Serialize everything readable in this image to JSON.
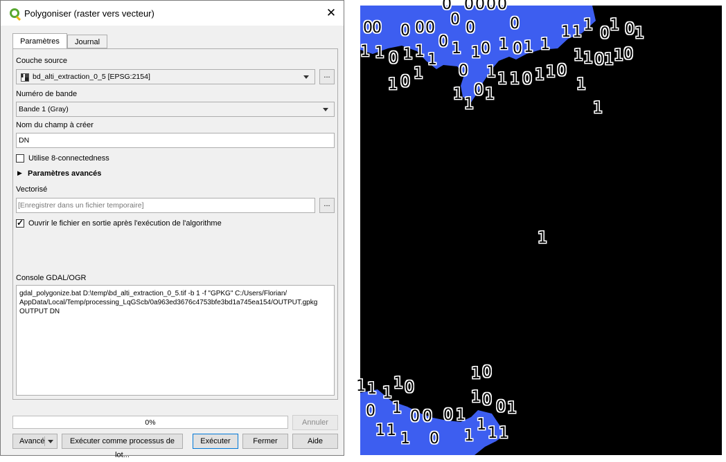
{
  "dialog": {
    "title": "Polygoniser (raster vers vecteur)",
    "close_glyph": "✕",
    "tabs": [
      "Paramètres",
      "Journal"
    ],
    "source_layer": {
      "label": "Couche source",
      "value": "bd_alti_extraction_0_5 [EPSG:2154]",
      "browse": "..."
    },
    "band": {
      "label": "Numéro de bande",
      "value": "Bande 1 (Gray)"
    },
    "field_name": {
      "label": "Nom du champ à créer",
      "value": "DN"
    },
    "eight_connect": {
      "label": "Utilise 8-connectedness",
      "checked": false
    },
    "advanced": {
      "label": "Paramètres avancés"
    },
    "vectorized": {
      "label": "Vectorisé",
      "placeholder": "[Enregistrer dans un fichier temporaire]",
      "browse": "..."
    },
    "open_output": {
      "label": "Ouvrir le fichier en sortie après l'exécution de l'algorithme",
      "checked": true
    },
    "console": {
      "label": "Console GDAL/OGR",
      "lines": [
        "gdal_polygonize.bat D:\\temp\\bd_alti_extraction_0_5.tif -b 1 -f \"GPKG\" C:/Users/Florian/",
        "AppData/Local/Temp/processing_LqGScb/0a963ed3676c4753bfe3bd1a745ea154/OUTPUT.gpkg",
        "OUTPUT DN"
      ]
    },
    "progress": {
      "text": "0%",
      "value": 0
    },
    "buttons": {
      "cancel": "Annuler",
      "advanced": "Avancé",
      "batch": "Exécuter comme processus de lot...",
      "run": "Exécuter",
      "close": "Fermer",
      "help": "Aide"
    }
  },
  "map": {
    "water_color": "#3d5ef0",
    "background_color": "#000000",
    "labels": [
      "0",
      "0",
      "0",
      "0",
      "0",
      "0",
      "0",
      "0",
      "1",
      "0",
      "0",
      "0",
      "0",
      "0",
      "0",
      "1",
      "1",
      "0",
      "1",
      "1",
      "1",
      "1",
      "0",
      "1",
      "0",
      "1",
      "1",
      "1",
      "0",
      "1",
      "0",
      "1",
      "1",
      "1",
      "0",
      "1",
      "1",
      "0",
      "1",
      "1",
      "0",
      "1",
      "1",
      "1",
      "1",
      "0",
      "1",
      "0",
      "1",
      "1",
      "1",
      "0",
      "1",
      "1",
      "0",
      "1",
      "1",
      "1",
      "1",
      "1",
      "1",
      "1",
      "0",
      "1",
      "0",
      "0",
      "1",
      "0",
      "0",
      "0",
      "1",
      "1",
      "0",
      "0",
      "1",
      "1",
      "1",
      "1",
      "0",
      "1",
      "1",
      "1",
      "1"
    ]
  }
}
